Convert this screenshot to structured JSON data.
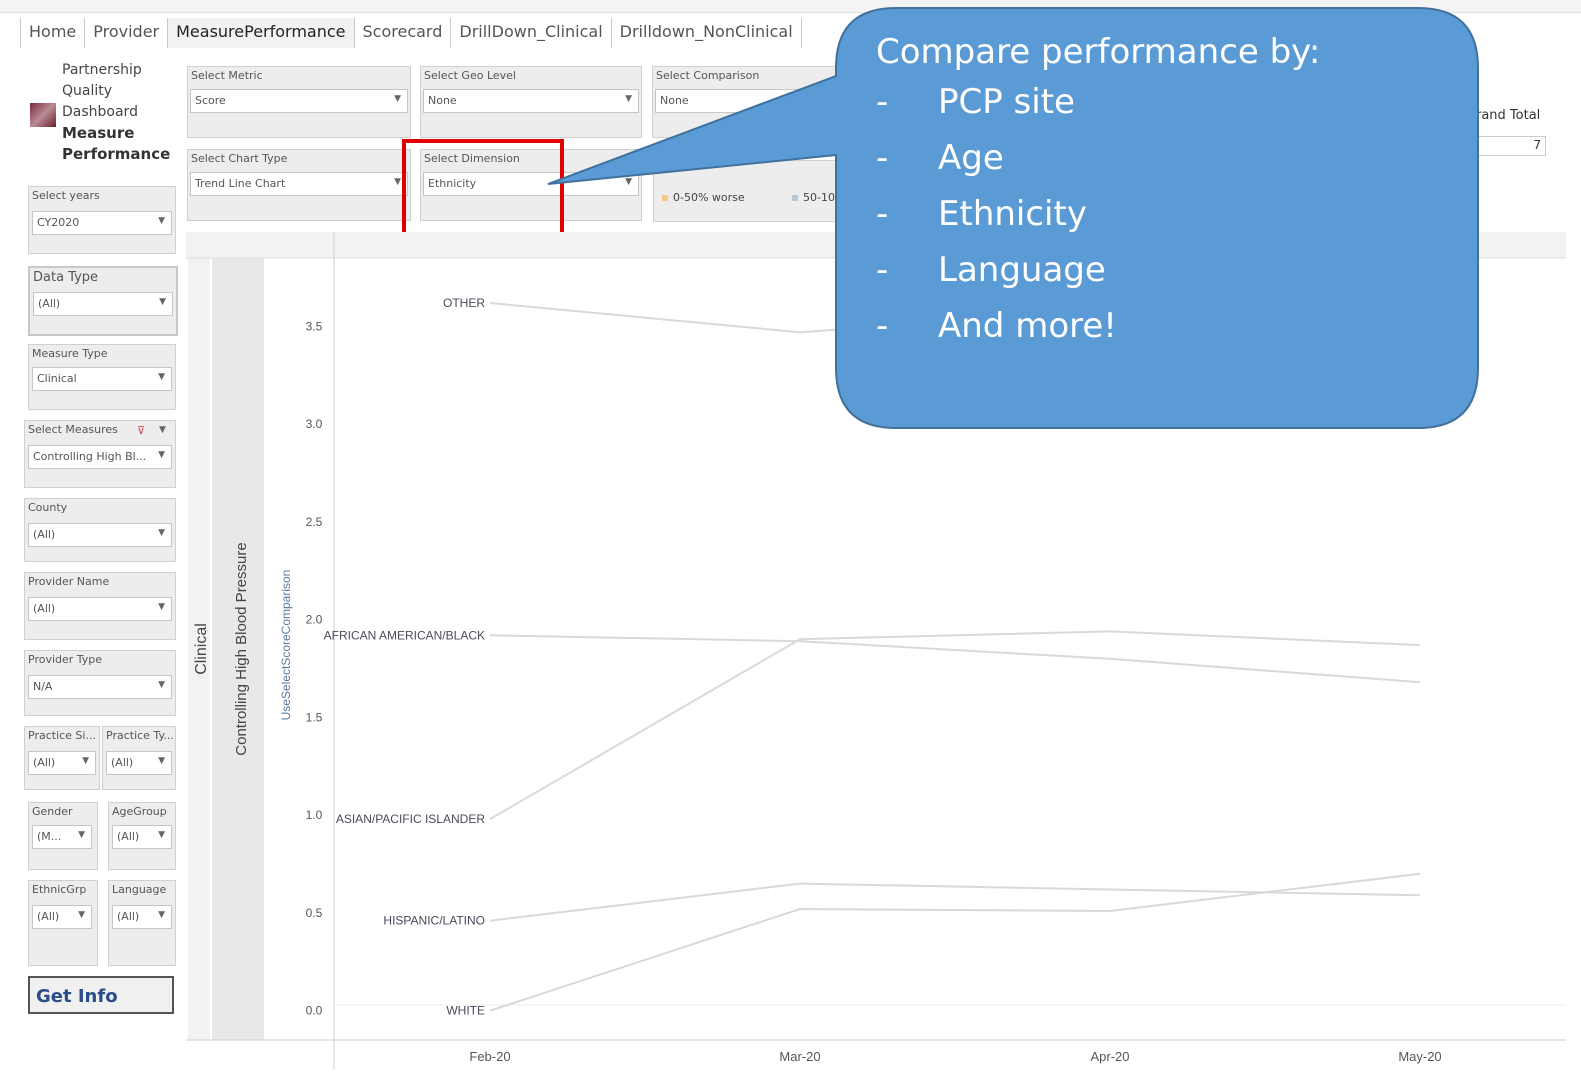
{
  "tabs": [
    "Home",
    "Provider",
    "MeasurePerformance",
    "Scorecard",
    "DrillDown_Clinical",
    "Drilldown_NonClinical"
  ],
  "active_tab": "MeasurePerformance",
  "logo": {
    "lines": [
      "Partnership",
      "Quality",
      "Dashboard"
    ],
    "bold_lines": [
      "Measure",
      "Performance"
    ]
  },
  "filters": {
    "select_metric": {
      "label": "Select Metric",
      "value": "Score"
    },
    "select_geo_level": {
      "label": "Select Geo Level",
      "value": "None"
    },
    "select_comparison": {
      "label": "Select Comparison",
      "value": "None"
    },
    "select_chart_type": {
      "label": "Select Chart Type",
      "value": "Trend Line Chart"
    },
    "select_dimension": {
      "label": "Select Dimension",
      "value": "Ethnicity"
    },
    "select_years": {
      "label": "Select years",
      "value": "CY2020"
    },
    "data_type": {
      "label": "Data Type",
      "value": "(All)"
    },
    "measure_type": {
      "label": "Measure Type",
      "value": "Clinical"
    },
    "select_measures": {
      "label": "Select Measures",
      "value": "Controlling High Bl..."
    },
    "county": {
      "label": "County",
      "value": "(All)"
    },
    "provider_name": {
      "label": "Provider Name",
      "value": "(All)"
    },
    "provider_type": {
      "label": "Provider Type",
      "value": "N/A"
    },
    "practice_si": {
      "label": "Practice Si...",
      "value": "(All)"
    },
    "practice_ty": {
      "label": "Practice Ty...",
      "value": "(All)"
    },
    "gender": {
      "label": "Gender",
      "value": "(M..."
    },
    "agegroup": {
      "label": "AgeGroup",
      "value": "(All)"
    },
    "ethnicgrp": {
      "label": "EthnicGrp",
      "value": "(All)"
    },
    "language": {
      "label": "Language",
      "value": "(All)"
    }
  },
  "legend": {
    "items": [
      "0-50% worse",
      "50-10"
    ],
    "colors": [
      "#f3c98a",
      "#b9c7d9"
    ]
  },
  "grand_total": {
    "label": "rand Total",
    "value": "7"
  },
  "get_info": "Get Info",
  "callout": {
    "title": "Compare performance by:",
    "items": [
      "PCP site",
      "Age",
      "Ethnicity",
      "Language",
      "And more!"
    ],
    "dash": "-",
    "color": "#5b9bd5",
    "border": "#41719c"
  },
  "highlight_color": "#e00000",
  "chart_data": {
    "type": "line",
    "row_headers": [
      "Clinical",
      "Controlling High Blood Pressure"
    ],
    "ylabel": "UseSelectScoreComparison",
    "x": [
      "Feb-20",
      "Mar-20",
      "Apr-20",
      "May-20"
    ],
    "ylim": [
      -0.15,
      3.85
    ],
    "yticks": [
      "0.0",
      "0.5",
      "1.0",
      "1.5",
      "2.0",
      "2.5",
      "3.0",
      "3.5"
    ],
    "series": [
      {
        "name": "OTHER",
        "values": [
          3.62,
          3.47,
          3.58,
          3.56
        ]
      },
      {
        "name": "AFRICAN AMERICAN/BLACK",
        "values": [
          1.92,
          1.89,
          1.8,
          1.68
        ]
      },
      {
        "name": "ASIAN/PACIFIC ISLANDER",
        "values": [
          0.98,
          1.9,
          1.94,
          1.87
        ]
      },
      {
        "name": "HISPANIC/LATINO",
        "values": [
          0.46,
          0.65,
          0.62,
          0.59
        ]
      },
      {
        "name": "WHITE",
        "values": [
          0.0,
          0.52,
          0.51,
          0.7
        ]
      }
    ],
    "line_color": "#d9d9d9"
  }
}
